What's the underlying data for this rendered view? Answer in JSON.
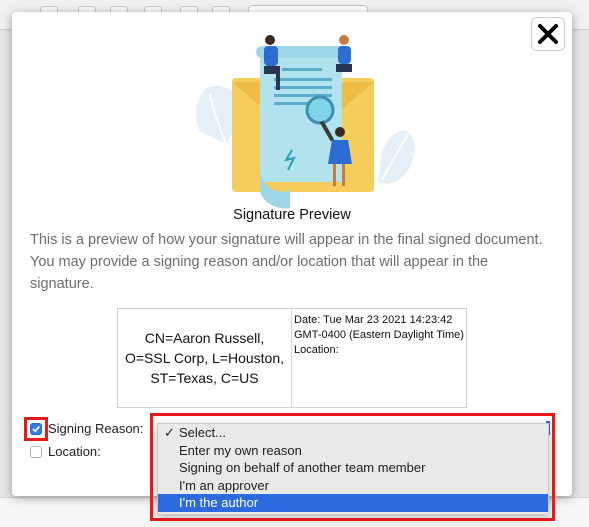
{
  "dialog": {
    "title": "Signature Preview",
    "description": "This is a preview of how your signature will appear in the final signed document. You may provide a signing reason and/or location that will appear in the signature.",
    "close_label": "✕"
  },
  "signature_preview": {
    "subject_lines": [
      "CN=Aaron Russell,",
      "O=SSL Corp, L=Houston,",
      "ST=Texas, C=US"
    ],
    "date_text": "Date: Tue Mar 23 2021 14:23:42 GMT-0400 (Eastern Daylight Time)",
    "location_text": "Location:"
  },
  "form": {
    "signing_reason": {
      "label": "Signing Reason:",
      "checked": true
    },
    "location": {
      "label": "Location:",
      "checked": false
    }
  },
  "reason_dropdown": {
    "options": [
      {
        "label": "Select...",
        "checked": true,
        "highlighted": false
      },
      {
        "label": "Enter my own reason",
        "checked": false,
        "highlighted": false
      },
      {
        "label": "Signing on behalf of another team member",
        "checked": false,
        "highlighted": false
      },
      {
        "label": "I'm an approver",
        "checked": false,
        "highlighted": false
      },
      {
        "label": "I'm the author",
        "checked": false,
        "highlighted": true
      }
    ],
    "check_glyph": "✓"
  },
  "colors": {
    "highlight": "#2d6ae0",
    "annotation_red": "#e8191a",
    "checkbox_blue": "#2f7ce8",
    "action_green": "#8cc63e"
  }
}
